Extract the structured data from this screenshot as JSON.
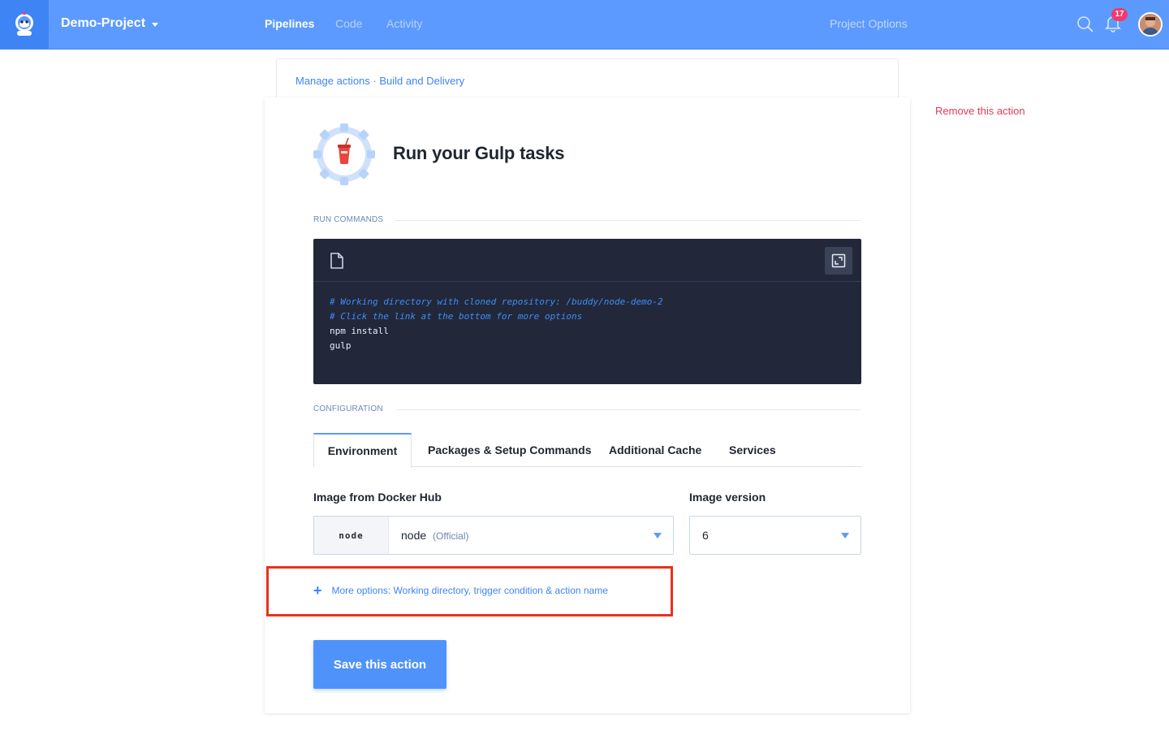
{
  "header": {
    "project_name": "Demo-Project",
    "nav": [
      {
        "label": "Pipelines",
        "active": true
      },
      {
        "label": "Code",
        "active": false
      },
      {
        "label": "Activity",
        "active": false
      }
    ],
    "project_options": "Project Options",
    "notifications_count": "17",
    "icons": [
      "buddy-logo-icon",
      "search-icon",
      "bell-icon",
      "avatar"
    ]
  },
  "breadcrumb": {
    "part1": "Manage actions",
    "separator": "·",
    "part2": "Build and Delivery"
  },
  "remove_action": "Remove this action",
  "action": {
    "title": "Run your Gulp tasks",
    "icon": "gulp-gear-icon"
  },
  "run_commands": {
    "label": "RUN COMMANDS",
    "lines": [
      {
        "text": "# Working directory with cloned repository: /buddy/node-demo-2",
        "comment": true
      },
      {
        "text": "# Click the link at the bottom for more options",
        "comment": true
      },
      {
        "text": "npm install",
        "comment": false
      },
      {
        "text": "gulp",
        "comment": false
      }
    ]
  },
  "configuration": {
    "label": "CONFIGURATION",
    "tabs": [
      "Environment",
      "Packages & Setup Commands",
      "Additional Cache",
      "Services"
    ],
    "active_tab": "Environment"
  },
  "image_field": {
    "label": "Image from Docker Hub",
    "logo_text": "node",
    "value": "node",
    "sub": "(Official)"
  },
  "version_field": {
    "label": "Image version",
    "value": "6"
  },
  "more_options": {
    "icon": "+",
    "label": "More options: Working directory, trigger condition & action name"
  },
  "save_button": "Save this action",
  "colors": {
    "topbar": "#5c9aff",
    "accent": "#3f84f5",
    "danger": "#e23a55",
    "editor_bg": "#22283a",
    "highlight_box": "#e8321c"
  }
}
